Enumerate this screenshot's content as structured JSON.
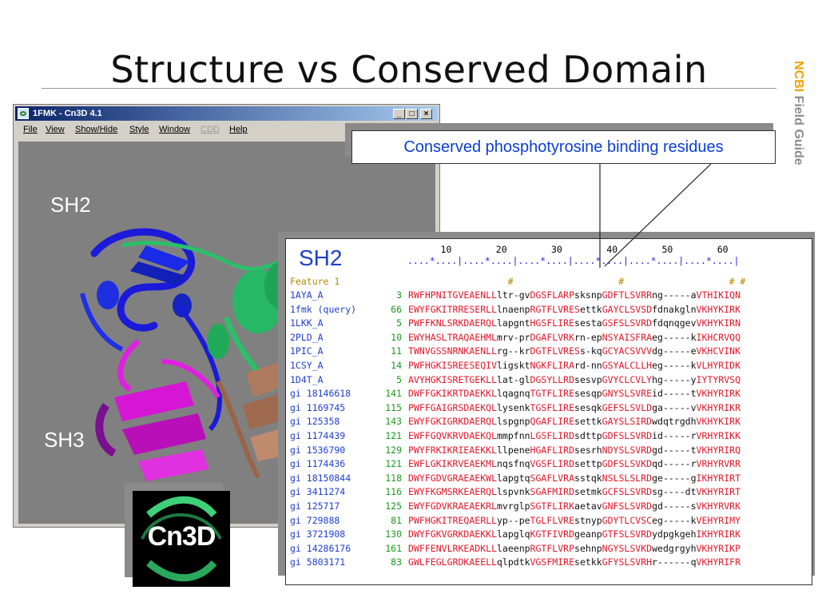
{
  "slide": {
    "title": "Structure vs Conserved Domain",
    "brand_ncbi": "NCBI",
    "brand_field_guide": " Field Guide"
  },
  "window": {
    "title": "1FMK - Cn3D 4.1",
    "controls": [
      "_",
      "□",
      "×"
    ],
    "menu": [
      "File",
      "View",
      "Show/Hide",
      "Style",
      "Window",
      "CDD",
      "Help"
    ],
    "label_sh2": "SH2",
    "label_sh3": "SH3"
  },
  "callout": {
    "text": "Conserved phosphotyrosine binding residues"
  },
  "alignment": {
    "title": "SH2",
    "ruler_numbers": "      10        20        30        40        50        60",
    "ruler_dots": "....*....|....*....|....*....|....*....|....*....|....*....|",
    "feature_label": "Feature 1",
    "feature_marks": "                  #                   #                   # #",
    "rows": [
      {
        "name": "1AYA_A",
        "start": "3",
        "seq": "RWFHPNITGVEAENLLltr-gvDGSFLARPsksnpGDFTLSVRRng-----aVTHIKIQN"
      },
      {
        "name": "1fmk (query)",
        "start": "66",
        "seq": "EWYFGKITRRESERLLlnaenpRGTFLVRESettkGAYCLSVSDfdnakglnVKHYKIRK"
      },
      {
        "name": "1LKK_A",
        "start": "5",
        "seq": "PWFFKNLSRKDAERQLlapgntHGSFLIREsestaGSFSLSVRDfdqnqgevVKHYKIRN"
      },
      {
        "name": "2PLD_A",
        "start": "10",
        "seq": "EWYHASLTRAQAEHMLmrv-prDGAFLVRKrn-epNSYAISFRAeg-----kIKHCRVQQ"
      },
      {
        "name": "1PIC_A",
        "start": "11",
        "seq": "TWNVGSSNRNKAENLLrg--krDGTFLVRESs-kqGCYACSVVVdg-----eVKHCVINK"
      },
      {
        "name": "1CSY_A",
        "start": "14",
        "seq": "PWFHGKISREESEQIVligsktNGKFLIRArd-nnGSYALCLLHeg-----kVLHYRIDK"
      },
      {
        "name": "1D4T_A",
        "start": "5",
        "seq": "AVYHGKISRETGEKLLlat-glDGSYLLRDsesvpGVYCLCVLYhg-----yIYTYRVSQ"
      },
      {
        "name": "gi 18146618",
        "start": "141",
        "seq": "DWFFGKIKRTDAEKKLlqagnqTGTFLIREsesqpGNYSLSVREid-----tVKHYRIRK"
      },
      {
        "name": "gi 1169745",
        "start": "115",
        "seq": "PWFFGAIGRSDAEKQLlysenkTGSFLIREsesqkGEFSLSVLDga-----vVKHYRIKR"
      },
      {
        "name": "gi 125358",
        "start": "143",
        "seq": "EWYFGKIGRKDAERQLlspgnpQGAFLIREsettkGAYSLSIRDwdqtrgdhVKHYKIRK"
      },
      {
        "name": "gi 1174439",
        "start": "121",
        "seq": "EWFFGQVKRVDAEKQLmmpfnnLGSFLIRDsdttpGDFSLSVRDid-----rVRHYRIKK"
      },
      {
        "name": "gi 1536790",
        "start": "129",
        "seq": "PWYFRKIKRIEAEKKLllpeneHGAFLIRDsesrhNDYSLSVRDgd-----tVKHYRIRQ"
      },
      {
        "name": "gi 1174436",
        "start": "121",
        "seq": "EWFLGKIKRVEAEKMLnqsfnqVGSFLIRDsettpGDFSLSVKDqd-----rVRHYRVRR"
      },
      {
        "name": "gi 18150844",
        "start": "118",
        "seq": "DWYFGDVGRAEAEKWLlapgtqSGAFLVRAsstqkNSLSLSLRDge-----gIKHYRIRT"
      },
      {
        "name": "gi 3411274",
        "start": "116",
        "seq": "EWYFKGMSRKEAERQLlspvnkSGAFMIRDsetmkGCFSLSVRDsg----dtVKHYRIRT"
      },
      {
        "name": "gi 125717",
        "start": "125",
        "seq": "EWYFGDVKRAEAEKRLmvrglpSGTFLIRKaetavGNFSLSVRDgd-----sVKHYRVRK"
      },
      {
        "name": "gi 729888",
        "start": "81",
        "seq": "PWFHGKITREQAERLLyp--peTGLFLVREstnypGDYTLCVSCeg-----kVEHYRIMY"
      },
      {
        "name": "gi 3721908",
        "start": "130",
        "seq": "DWYFGKVGRKDAEKKLlapglqKGTFIVRDgeanpGTFSLSVRDydpgkgehIKHYRIRK"
      },
      {
        "name": "gi 14286176",
        "start": "161",
        "seq": "DWFFENVLRKEADKLLlaeenpRGTFLVRPsehnpNGYSLSVKDwedgrgyhVKHYRIKP"
      },
      {
        "name": "gi 5803171",
        "start": "83",
        "seq": "GWLFEGLGRDKAEELLqlpdtkVGSFMIREsetkkGFYSLSVRHr------qVKHYRIFR"
      }
    ]
  },
  "logo": {
    "text": "Cn3D"
  },
  "colors": {
    "accent_blue": "#1e3fcc",
    "aligned_red": "#e0182a",
    "number_green": "#1a9a1a",
    "brand_orange": "#f2a100"
  }
}
